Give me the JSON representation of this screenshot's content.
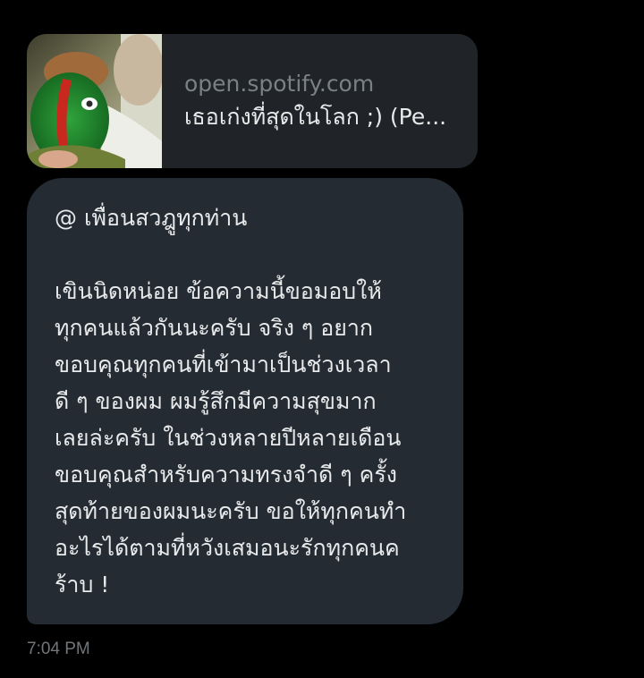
{
  "link_card": {
    "domain": "open.spotify.com",
    "title": "เธอเก่งที่สุดในโลก ;) (Pe..."
  },
  "message": {
    "mention": "@ เพื่อนสวฎูทุกท่าน",
    "lines": [
      "เขินนิดหน่อย ข้อความนี้ขอมอบให้",
      "ทุกคนแล้วกันนะครับ จริง ๆ อยาก",
      "ขอบคุณทุกคนที่เข้ามาเป็นช่วงเวลา",
      "ดี ๆ ของผม ผมรู้สึกมีความสุขมาก",
      "เลยล่ะครับ ในช่วงหลายปีหลายเดือน",
      "ขอบคุณสำหรับความทรงจำดี ๆ ครั้ง",
      "สุดท้ายของผมนะครับ ขอให้ทุกคนทำ",
      "อะไรได้ตามที่หวังเสมอนะรักทุกคนค",
      "ร้าบ !"
    ]
  },
  "timestamp": "7:04 PM",
  "colors": {
    "background": "#000000",
    "card": "#202327",
    "bubble": "#242b33",
    "text": "#e7e9ea",
    "muted": "#71767b"
  }
}
